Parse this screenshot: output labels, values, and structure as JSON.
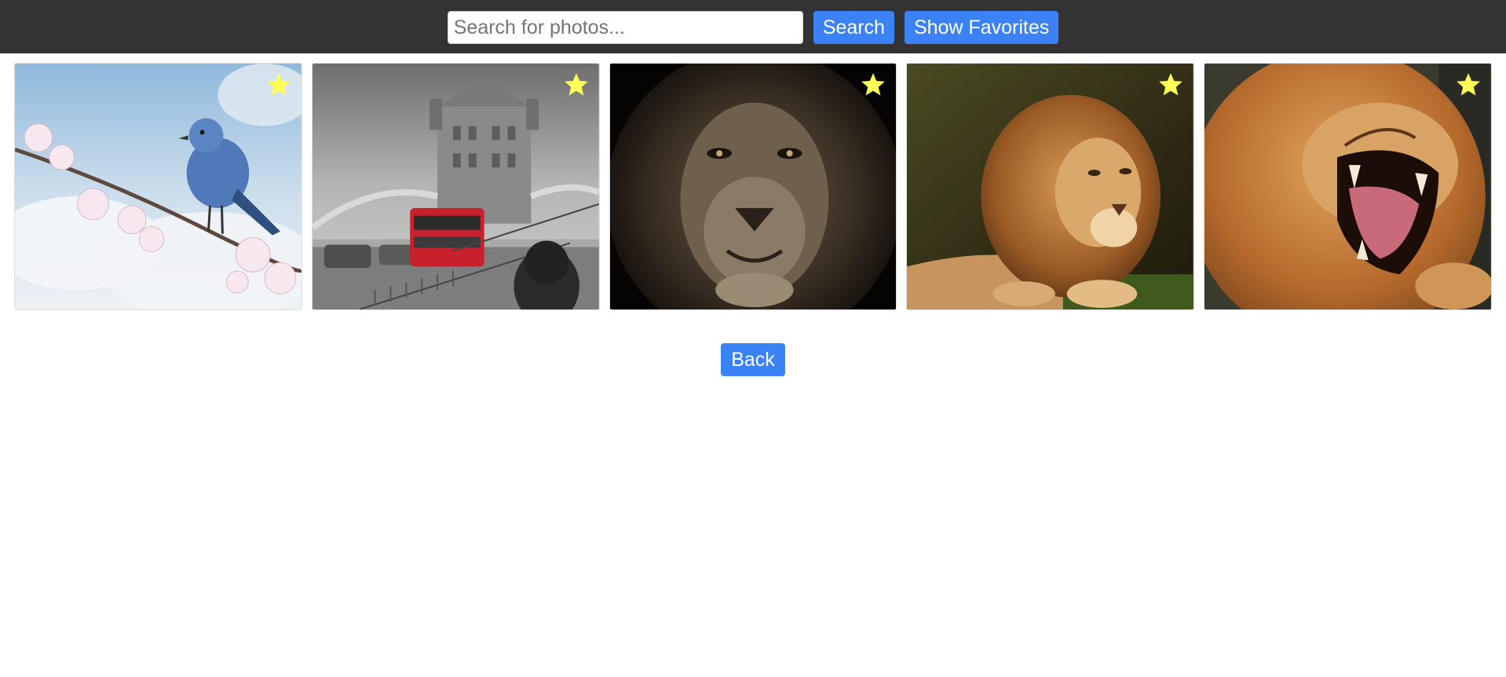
{
  "header": {
    "search_placeholder": "Search for photos...",
    "search_value": "",
    "search_button_label": "Search",
    "favorites_button_label": "Show Favorites"
  },
  "gallery": {
    "photos": [
      {
        "subject": "blue bird on blossom branch",
        "favorited": true
      },
      {
        "subject": "tower bridge with red bus",
        "favorited": true
      },
      {
        "subject": "lion face dark",
        "favorited": true
      },
      {
        "subject": "lion resting on grass",
        "favorited": true
      },
      {
        "subject": "lion yawning",
        "favorited": true
      }
    ],
    "star_icon": "star-icon",
    "star_color": "#ffff55"
  },
  "footer": {
    "back_button_label": "Back"
  },
  "colors": {
    "topbar": "#333333",
    "accent": "#3b82f6"
  }
}
